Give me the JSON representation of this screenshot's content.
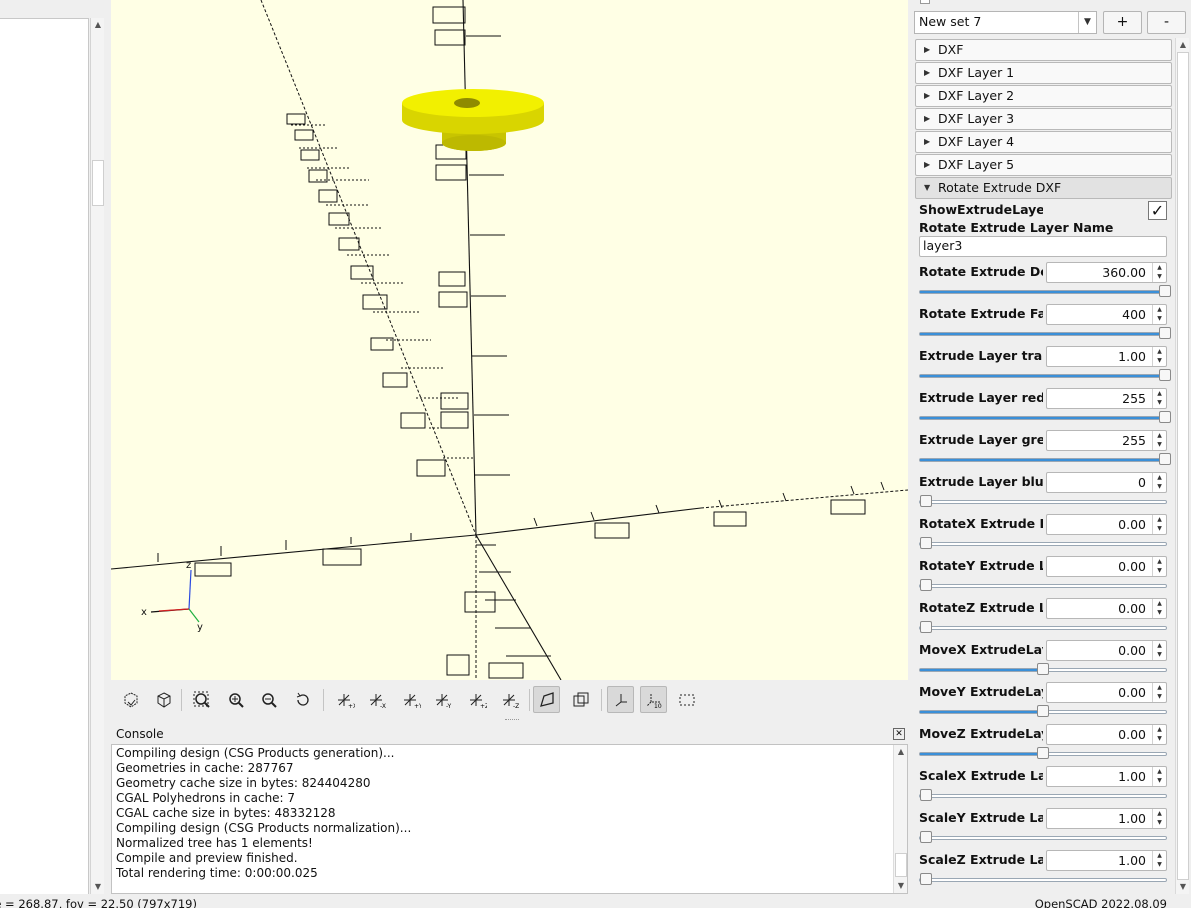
{
  "viewport": {
    "model_color": "#f2f000",
    "background": "#ffffe5"
  },
  "console": {
    "title": "Console",
    "lines": [
      "Compiling design (CSG Products generation)...",
      "Geometries in cache: 287767",
      "Geometry cache size in bytes: 824404280",
      "CGAL Polyhedrons in cache: 7",
      "CGAL cache size in bytes: 48332128",
      "Compiling design (CSG Products normalization)...",
      "Normalized tree has 1 elements!",
      "Compile and preview finished.",
      "Total rendering time: 0:00:00.025"
    ]
  },
  "status": {
    "left": "ce = 268.87, fov = 22.50 (797x719)",
    "right": "OpenSCAD 2022.08.09"
  },
  "customizer": {
    "preset": "New set 7",
    "add_label": "+",
    "remove_label": "-",
    "groups": [
      "DXF",
      "DXF Layer 1",
      "DXF Layer 2",
      "DXF Layer 3",
      "DXF Layer 4",
      "DXF Layer 5"
    ],
    "open_group": "Rotate Extrude DXF",
    "show_label": "ShowExtrudeLayer",
    "show_checked": true,
    "name_label": "Rotate Extrude Layer Name",
    "name_value": "layer3",
    "params": [
      {
        "label": "Rotate Extrude De",
        "value": "360.00",
        "level": 1.0
      },
      {
        "label": "Rotate Extrude Fa",
        "value": "400",
        "level": 1.0
      },
      {
        "label": "Extrude Layer trar",
        "value": "1.00",
        "level": 1.0
      },
      {
        "label": "Extrude Layer red",
        "value": "255",
        "level": 1.0
      },
      {
        "label": "Extrude Layer gre",
        "value": "255",
        "level": 1.0
      },
      {
        "label": "Extrude Layer blu",
        "value": "0",
        "level": 0.0
      },
      {
        "label": "RotateX Extrude L",
        "value": "0.00",
        "level": 0.0
      },
      {
        "label": "RotateY Extrude L",
        "value": "0.00",
        "level": 0.0
      },
      {
        "label": "RotateZ Extrude L",
        "value": "0.00",
        "level": 0.0
      },
      {
        "label": "MoveX ExtrudeLay",
        "value": "0.00",
        "level": 0.5
      },
      {
        "label": "MoveY ExtrudeLay",
        "value": "0.00",
        "level": 0.5
      },
      {
        "label": "MoveZ ExtrudeLay",
        "value": "0.00",
        "level": 0.5
      },
      {
        "label": "ScaleX Extrude La",
        "value": "1.00",
        "level": 0.0
      },
      {
        "label": "ScaleY Extrude La",
        "value": "1.00",
        "level": 0.0
      },
      {
        "label": "ScaleZ Extrude La",
        "value": "1.00",
        "level": 0.0
      }
    ]
  }
}
